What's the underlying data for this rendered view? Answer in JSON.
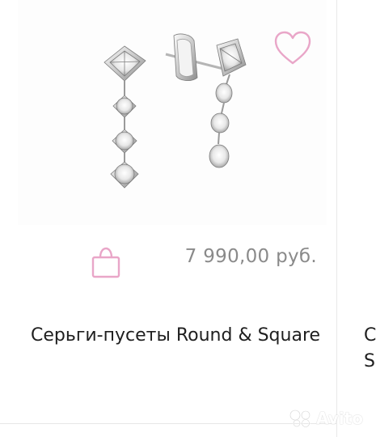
{
  "product": {
    "title": "Серьги-пусеты Round & Square",
    "price": "7 990,00 руб.",
    "image_icon": "earrings-product-photo"
  },
  "actions": {
    "wishlist_icon": "heart-outline-icon",
    "cart_icon": "shopping-bag-icon",
    "accent_color": "#e9a6c8"
  },
  "next_product": {
    "title_line1": "С",
    "title_line2": "S"
  },
  "watermark": {
    "text": "Avito"
  }
}
